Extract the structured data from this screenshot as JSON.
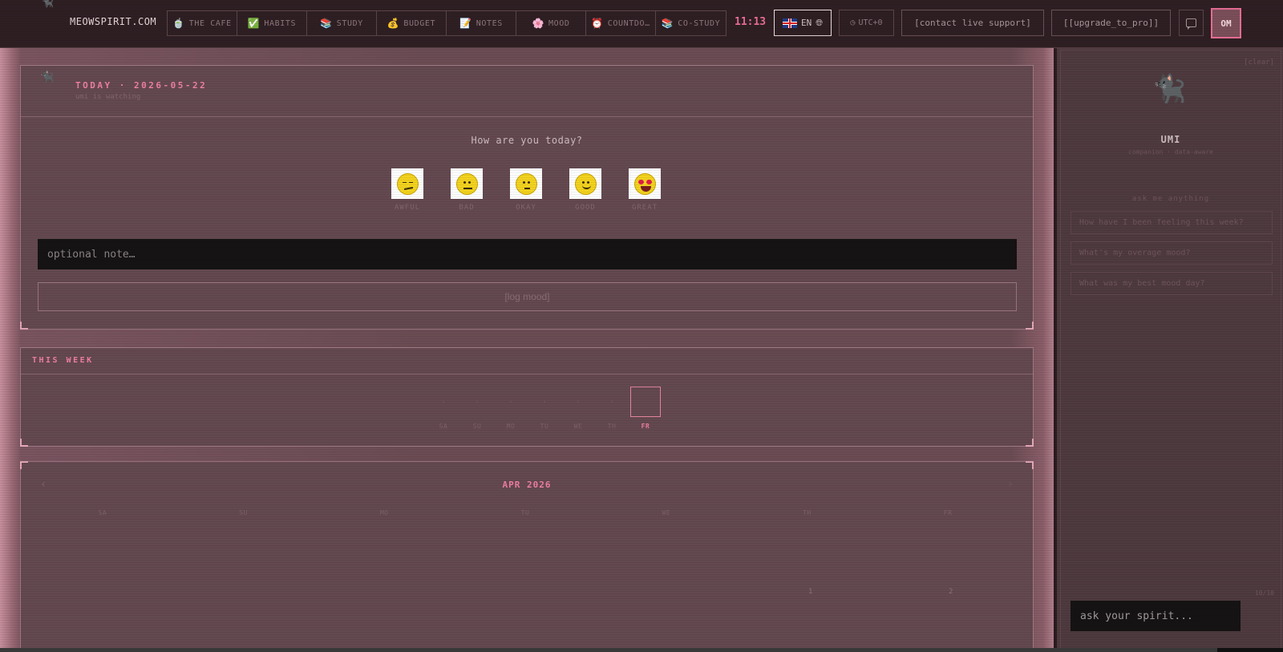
{
  "header": {
    "brand": "MEOWSPIRIT.COM",
    "nav": [
      {
        "label": "THE CAFE",
        "icon": "🍵"
      },
      {
        "label": "HABITS",
        "icon": "✅"
      },
      {
        "label": "STUDY",
        "icon": "📚"
      },
      {
        "label": "BUDGET",
        "icon": "💰"
      },
      {
        "label": "NOTES",
        "icon": "📝"
      },
      {
        "label": "MOOD",
        "icon": "🌸"
      },
      {
        "label": "COUNTDO…",
        "icon": "⏰"
      },
      {
        "label": "CO-STUDY",
        "icon": "📚"
      }
    ],
    "clock": "11:13",
    "language": "EN",
    "timezone": "UTC+0",
    "support_label": "[contact live support]",
    "upgrade_label": "[[upgrade_to_pro]]",
    "avatar_initials": "OM"
  },
  "today": {
    "title": "TODAY · 2026-05-22",
    "subtitle": "umi is watching",
    "question": "How are you today?",
    "moods": [
      "AWFUL",
      "BAD",
      "OKAY",
      "GOOD",
      "GREAT"
    ],
    "note_placeholder": "optional note…",
    "log_button": "[log mood]"
  },
  "week": {
    "title": "THIS WEEK",
    "days": [
      {
        "label": "SA",
        "value": "·"
      },
      {
        "label": "SU",
        "value": "·"
      },
      {
        "label": "MO",
        "value": "·"
      },
      {
        "label": "TU",
        "value": "·"
      },
      {
        "label": "WE",
        "value": "·"
      },
      {
        "label": "TH",
        "value": "·"
      },
      {
        "label": "FR",
        "value": ""
      }
    ]
  },
  "calendar": {
    "title": "APR 2026",
    "prev": "‹",
    "next": "›",
    "weekdays": [
      "SA",
      "SU",
      "MO",
      "TU",
      "WE",
      "TH",
      "FR"
    ],
    "first_days": [
      "1",
      "2"
    ]
  },
  "sidebar": {
    "clear_label": "[clear]",
    "name": "UMI",
    "subtitle": "companion · data-aware",
    "ask_label": "ask me anything",
    "suggestions": [
      "How have I been feeling this week?",
      "What's my overage mood?",
      "What was my best mood day?"
    ],
    "message_count": "10/10",
    "input_placeholder": "ask your spirit..."
  },
  "colors": {
    "accent": "#ee7fa2",
    "panel": "#644950",
    "topbar": "#2e1f23"
  }
}
